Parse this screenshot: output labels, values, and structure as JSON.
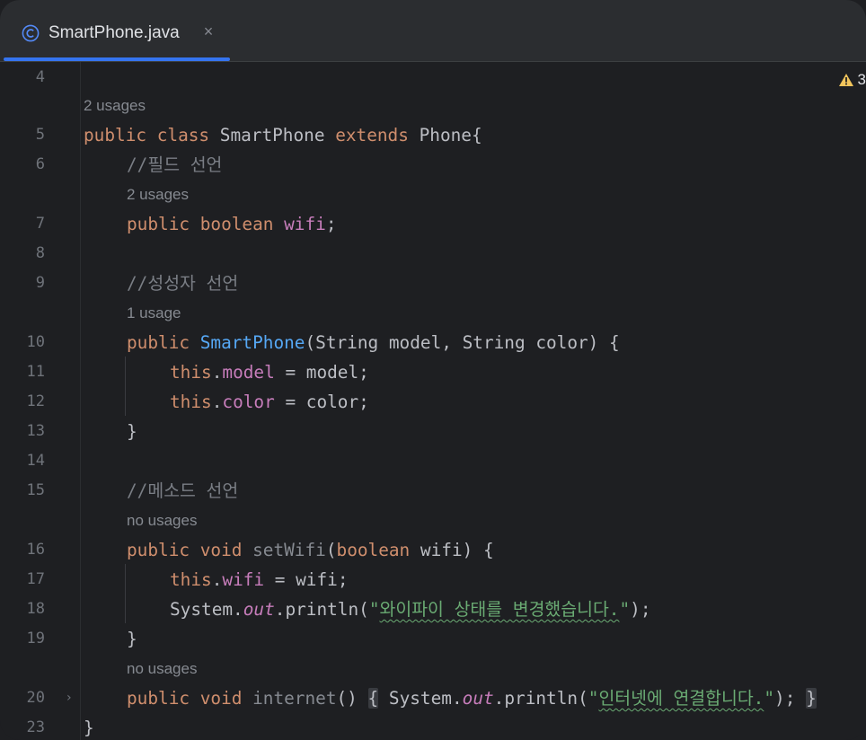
{
  "tab": {
    "filename": "SmartPhone.java",
    "close": "×"
  },
  "inspection": {
    "warnings": "3"
  },
  "lines": {
    "l4": {
      "num": "4"
    },
    "u1": {
      "hint": "2 usages"
    },
    "l5": {
      "num": "5",
      "kw": "public class ",
      "name": "SmartPhone ",
      "ext": "extends ",
      "rest": "Phone{"
    },
    "l6": {
      "num": "6",
      "comment": "//필드 선언"
    },
    "u2": {
      "hint": "2 usages"
    },
    "l7": {
      "num": "7",
      "kw": "public boolean ",
      "field": "wifi",
      "rest": ";"
    },
    "l8": {
      "num": "8"
    },
    "l9": {
      "num": "9",
      "comment": "//성성자 선언"
    },
    "u3": {
      "hint": "1 usage"
    },
    "l10": {
      "num": "10",
      "kw": "public ",
      "fn": "SmartPhone",
      "rest": "(String model, String color) {"
    },
    "l11": {
      "num": "11",
      "kw": "this",
      "dot": ".",
      "field": "model",
      "rest": " = model;"
    },
    "l12": {
      "num": "12",
      "kw": "this",
      "dot": ".",
      "field": "color",
      "rest": " = color;"
    },
    "l13": {
      "num": "13",
      "code": "}"
    },
    "l14": {
      "num": "14"
    },
    "l15": {
      "num": "15",
      "comment": "//메소드 선언"
    },
    "u4": {
      "hint": "no usages"
    },
    "l16": {
      "num": "16",
      "kw": "public void ",
      "fn": "setWifi",
      "p1": "(",
      "kw2": "boolean",
      "rest": " wifi) {"
    },
    "l17": {
      "num": "17",
      "kw": "this",
      "dot": ".",
      "field": "wifi",
      "rest": " = wifi;"
    },
    "l18": {
      "num": "18",
      "sys": "System.",
      "out": "out",
      "call": ".println(",
      "q1": "\"",
      "str": "와이파이 상태를 변경했습니다.",
      "q2": "\"",
      "end": ");"
    },
    "l19": {
      "num": "19",
      "code": "}"
    },
    "u5": {
      "hint": "no usages"
    },
    "l20": {
      "num": "20",
      "fold": "›",
      "kw": "public void ",
      "fn": "internet",
      "paren": "()",
      "sp": " ",
      "ob": "{",
      "sys": " System.",
      "out": "out",
      "call": ".println(",
      "q1": "\"",
      "str": "인터넷에 연결합니다.",
      "q2": "\"",
      "end": ");",
      "cb": "}"
    },
    "l23": {
      "num": "23",
      "code": "}"
    }
  }
}
